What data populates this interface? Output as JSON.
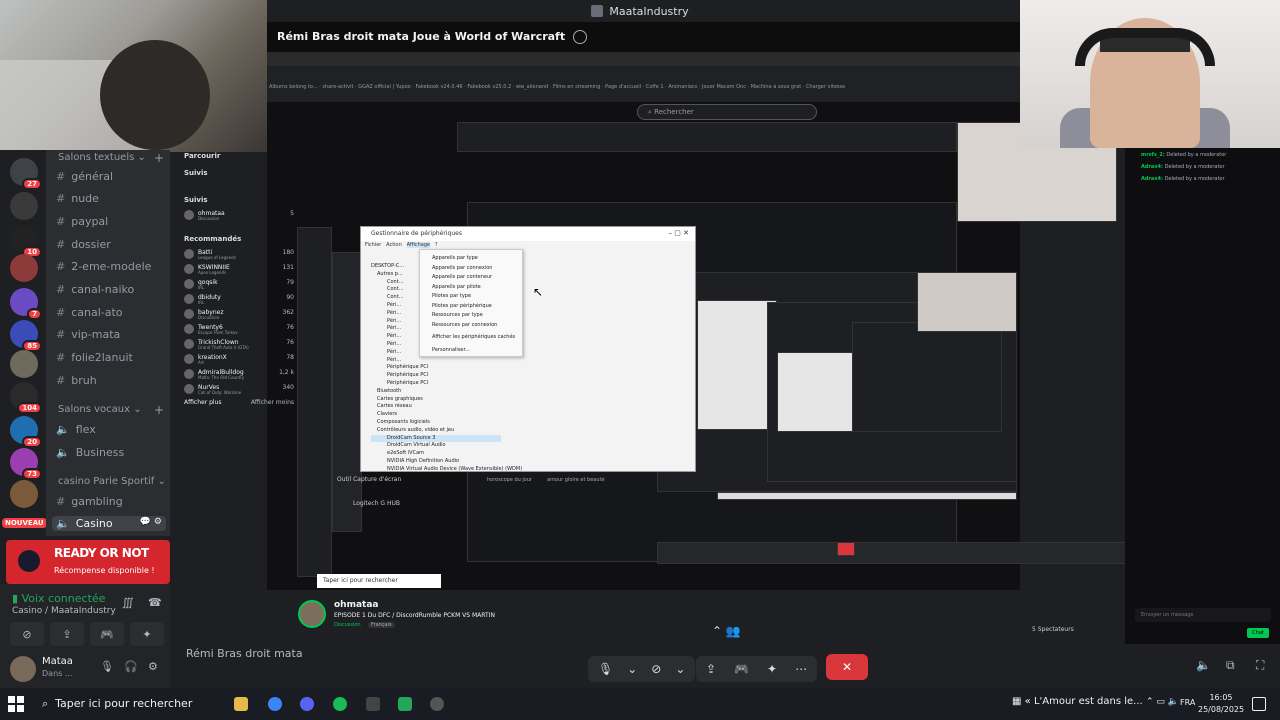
{
  "top_title": "MaataIndustry",
  "stream": {
    "title": "Rémi Bras droit mata Joue à World of Warcraft",
    "search_placeholder": "Rechercher",
    "brand": "MaataIndustry",
    "bookmarks": "Albums belong to... · share-activit · GGAZ official | Yupoo · Fakebook v24.0.46 · Fakebook v25.0.2 · ww_alienand · Films en streaming · Page d'accueil · Coffe 1 · Animaniacs · Jouer Macam Onc · Machine à sous grat · Charger vitesse"
  },
  "nav": {
    "parcourir": "Parcourir",
    "suivis": "Suivis",
    "suivis_header": "Suivis",
    "recommended_header": "Recommandés",
    "followed": [
      {
        "name": "ohmataa",
        "game": "Discussion",
        "count": "5"
      }
    ],
    "recommended": [
      {
        "name": "Batti",
        "game": "League of Legends",
        "count": "180"
      },
      {
        "name": "KSWINNIIE",
        "game": "Apex Legends",
        "count": "131"
      },
      {
        "name": "qoqsik",
        "game": "IRL",
        "count": "79"
      },
      {
        "name": "dbiduty",
        "game": "IRL",
        "count": "90"
      },
      {
        "name": "babynez",
        "game": "Discussion",
        "count": "362"
      },
      {
        "name": "Twenty6",
        "game": "Escape From Tarkov",
        "count": "76"
      },
      {
        "name": "TrickishClown",
        "game": "Grand Theft Auto V (GTA)",
        "count": "76"
      },
      {
        "name": "kreationX",
        "game": "Art",
        "count": "78"
      },
      {
        "name": "AdmiralBulldog",
        "game": "Mafia: The Old Country",
        "count": "1,2 k"
      },
      {
        "name": "NurVes",
        "game": "Call of Duty: Warzone",
        "count": "340"
      }
    ],
    "show_more": "Afficher plus",
    "show_less": "Afficher moins"
  },
  "channels": {
    "text_header": "Salons textuels",
    "text": [
      "général",
      "nude",
      "paypal",
      "dossier",
      "2-eme-modele",
      "canal-naiko",
      "canal-ato",
      "vip-mata",
      "folie2lanuit",
      "bruh"
    ],
    "voice_header": "Salons vocaux",
    "voice": [
      "flex",
      "Business"
    ],
    "casino_header": "casino Parie Sportif",
    "casino": [
      "gambling",
      "Casino"
    ]
  },
  "servers": [
    {
      "badge": "27"
    },
    {
      "badge": ""
    },
    {
      "badge": "10"
    },
    {
      "badge": ""
    },
    {
      "badge": "7"
    },
    {
      "badge": "85"
    },
    {
      "badge": ""
    },
    {
      "badge": "104"
    },
    {
      "badge": "20"
    },
    {
      "badge": "73"
    },
    {
      "badge": ""
    }
  ],
  "new_badge": "NOUVEAU",
  "ad": {
    "title": "READY OR NOT",
    "subtitle": "Récompense disponible !"
  },
  "voice": {
    "status": "Voix connectée",
    "channel": "Casino / MaataIndustry"
  },
  "user": {
    "name": "Mataa",
    "status": "Dans ..."
  },
  "devmgr": {
    "title": "Gestionnaire de périphériques",
    "menu": [
      "Fichier",
      "Action",
      "Affichage",
      "?"
    ],
    "view_items": [
      "Appareils par type",
      "Appareils par connexion",
      "Appareils par conteneur",
      "Appareils par pilote",
      "Pilotes par type",
      "Pilotes par périphérique",
      "Ressources par type",
      "Ressources par connexion",
      "Afficher les périphériques cachés",
      "Personnaliser..."
    ],
    "tree": [
      "DESKTOP-C...",
      "Autres p...",
      "Cont...",
      "Cont...",
      "Cont...",
      "Péri...",
      "Péri...",
      "Péri...",
      "Péri...",
      "Péri...",
      "Péri...",
      "Péri...",
      "Péri...",
      "Périphérique PCI",
      "Périphérique PCI",
      "Périphérique PCI",
      "Bluetooth",
      "Cartes graphiques",
      "Cartes réseau",
      "Claviers",
      "Composants logiciels",
      "Contrôleurs audio, vidéo et jeu",
      "DroidCam Source 3",
      "DroidCam Virtual Audio",
      "e2eSoft iVCam",
      "NVIDIA High Definition Audio",
      "NVIDIA Virtual Audio Device (Wave Extensible) (WDM)"
    ]
  },
  "inner_strings": {
    "capture": "Outil Capture d'écran",
    "hub": "Logitech G HUB",
    "tag1": "horoscope du jour",
    "tag2": "amour gloire et beauté",
    "search": "Taper ici pour rechercher"
  },
  "stream_info": {
    "name": "ohmataa",
    "title": "EPISODE 1 Du DFC / DiscordRumble PCKM VS MARTIN",
    "game": "Discussion",
    "tag": "Français",
    "viewers": "5 Spectateurs"
  },
  "chat": {
    "messages": [
      {
        "user": "mrsfs_2:",
        "text": "Deleted by a moderator"
      },
      {
        "user": "Adrax4:",
        "text": "Deleted by a moderator"
      },
      {
        "user": "Adrax4:",
        "text": "Deleted by a moderator"
      }
    ],
    "placeholder": "Envoyer un message",
    "send": "Chat"
  },
  "bottom_bar": {
    "label": "Rémi Bras droit mata"
  },
  "taskbar": {
    "search": "Taper ici pour rechercher",
    "media": "« L'Amour est dans le...",
    "lang": "FRA",
    "time": "16:05",
    "date": "25/08/2025"
  },
  "colors": {
    "discord_bg": "#1e1f22",
    "accent_green": "#23a55a",
    "danger": "#da373c",
    "twitch_green": "#00c853"
  }
}
